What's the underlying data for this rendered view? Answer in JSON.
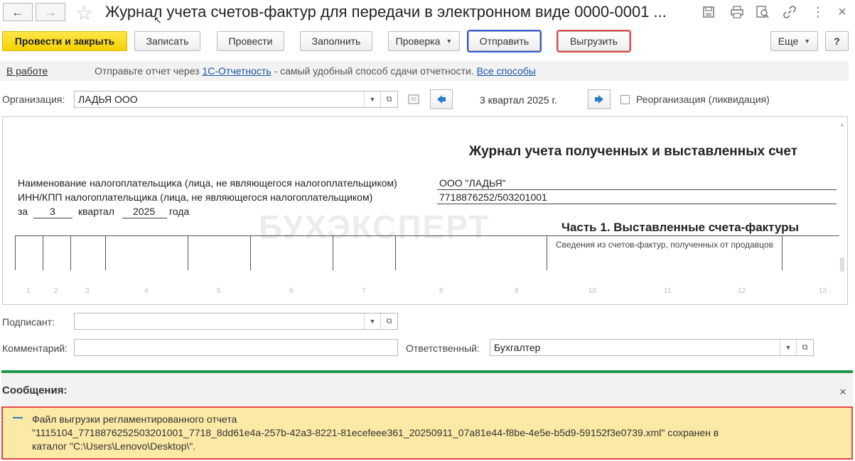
{
  "window": {
    "title": "Журнал учета счетов-фактур для передачи в электронном виде 0000-0001 ..."
  },
  "toolbar": {
    "post_close": "Провести и закрыть",
    "write": "Записать",
    "post": "Провести",
    "fill": "Заполнить",
    "check": "Проверка",
    "send": "Отправить",
    "export": "Выгрузить",
    "more": "Еще",
    "help": "?"
  },
  "status": {
    "state_link": "В работе",
    "hint_prefix": "Отправьте отчет через",
    "hint_link": "1С-Отчетность",
    "hint_suffix": "- самый удобный способ сдачи отчетности.",
    "all_methods_link": "Все способы"
  },
  "org": {
    "label": "Организация:",
    "value": "ЛАДЬЯ ООО",
    "period": "3 квартал 2025 г.",
    "reorg_label": "Реорганизация (ликвидация)"
  },
  "document": {
    "heading": "Журнал учета полученных и выставленных счет",
    "taxpayer_label": "Наименование налогоплательщика (лица, не являющегося налогоплательщиком)",
    "taxpayer_value": "ООО \"ЛАДЬЯ\"",
    "inn_label": "ИНН/КПП налогоплательщика (лица, не являющегося налогоплательщиком)",
    "inn_value": "7718876252/503201001",
    "za": "за",
    "quarter_num": "3",
    "quarter_word": "квартал",
    "year": "2025",
    "year_word": "года",
    "part1": "Часть 1. Выставленные счета-фактуры",
    "table_header_cell": "Сведения из счетов-фактур, полученных от продавцов",
    "watermark": "БУХЭКСПЕРТ",
    "column_numbers": [
      "1",
      "2",
      "3",
      "4",
      "5",
      "6",
      "7",
      "8",
      "9",
      "10",
      "11",
      "12",
      "13"
    ]
  },
  "signer": {
    "label": "Подписант:",
    "value": ""
  },
  "comment": {
    "label": "Комментарий:",
    "value": ""
  },
  "responsible": {
    "label": "Ответственный:",
    "value": "Бухгалтер"
  },
  "messages": {
    "title": "Сообщения:",
    "line1": "Файл выгрузки регламентированного отчета",
    "line2": "\"1115104_7718876252503201001_7718_8dd61e4a-257b-42a3-8221-81ecefeee361_20250911_07a81e44-f8be-4e5e-b5d9-59152f3e0739.xml\" сохранен в",
    "line3": "каталог \"C:\\Users\\Lenovo\\Desktop\\\"."
  },
  "colors": {
    "primary_button": "#f5d100",
    "highlight_blue": "#2c56d6",
    "highlight_red": "#e34646",
    "separator_green": "#1c9a4a",
    "message_bg": "#fbe9a6",
    "link": "#1a56a6"
  }
}
